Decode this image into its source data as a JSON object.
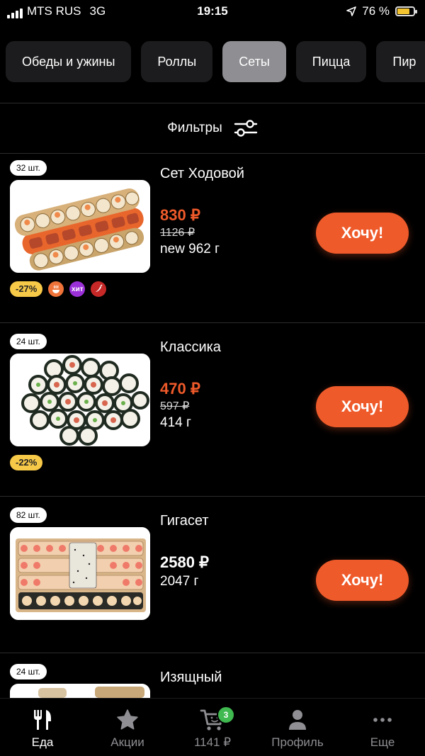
{
  "status_bar": {
    "carrier": "MTS RUS",
    "network": "3G",
    "time": "19:15",
    "battery_percent": "76 %",
    "battery_level": 0.76
  },
  "categories": [
    {
      "label": "Обеды и ужины",
      "active": false
    },
    {
      "label": "Роллы",
      "active": false
    },
    {
      "label": "Сеты",
      "active": true
    },
    {
      "label": "Пицца",
      "active": false
    },
    {
      "label": "Пир",
      "active": false
    }
  ],
  "filters": {
    "label": "Фильтры",
    "icon": "sliders-icon"
  },
  "products": [
    {
      "count": "32 шт.",
      "name": "Сет Ходовой",
      "price": "830 ₽",
      "old_price": "1126 ₽",
      "weight": "new 962 г",
      "button": "Хочу!",
      "discount": "-27%",
      "badges": [
        {
          "icon": "hot-dish-icon",
          "text": "",
          "color": "#f0733a"
        },
        {
          "icon": "hit-icon",
          "text": "хит",
          "color": "#9b30d9"
        },
        {
          "icon": "chili-icon",
          "text": "",
          "color": "#c62828"
        }
      ]
    },
    {
      "count": "24 шт.",
      "name": "Классика",
      "price": "470 ₽",
      "old_price": "597 ₽",
      "weight": "414 г",
      "button": "Хочу!",
      "discount": "-22%",
      "badges": []
    },
    {
      "count": "82 шт.",
      "name": "Гигасет",
      "price": "2580 ₽",
      "old_price": "",
      "weight": "2047 г",
      "button": "Хочу!",
      "discount": "",
      "badges": []
    },
    {
      "count": "24 шт.",
      "name": "Изящный"
    }
  ],
  "tab_bar": [
    {
      "label": "Еда",
      "icon": "fork-knife-icon",
      "active": true
    },
    {
      "label": "Акции",
      "icon": "star-icon",
      "active": false
    },
    {
      "label": "1141 ₽",
      "icon": "cart-icon",
      "active": false,
      "badge": "3"
    },
    {
      "label": "Профиль",
      "icon": "profile-icon",
      "active": false
    },
    {
      "label": "Еще",
      "icon": "more-icon",
      "active": false
    }
  ],
  "colors": {
    "accent": "#ef5a2a",
    "sale_price": "#ef5a2a",
    "discount_tag": "#f7c948",
    "cart_badge": "#3fb950",
    "active_tab": "#8e8e93",
    "tab_bg": "#1c1c1e"
  }
}
